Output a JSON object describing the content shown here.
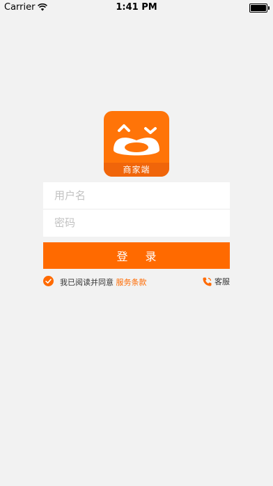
{
  "status_bar": {
    "carrier": "Carrier",
    "time": "1:41 PM"
  },
  "logo": {
    "label": "商家端"
  },
  "form": {
    "username_placeholder": "用户名",
    "password_placeholder": "密码"
  },
  "login_button": "登 录",
  "agreement": {
    "text": "我已阅读并同意",
    "link": "服务条款",
    "checked": true
  },
  "service": {
    "label": "客服"
  },
  "colors": {
    "accent": "#ff6a00",
    "background": "#f2f2f2"
  }
}
